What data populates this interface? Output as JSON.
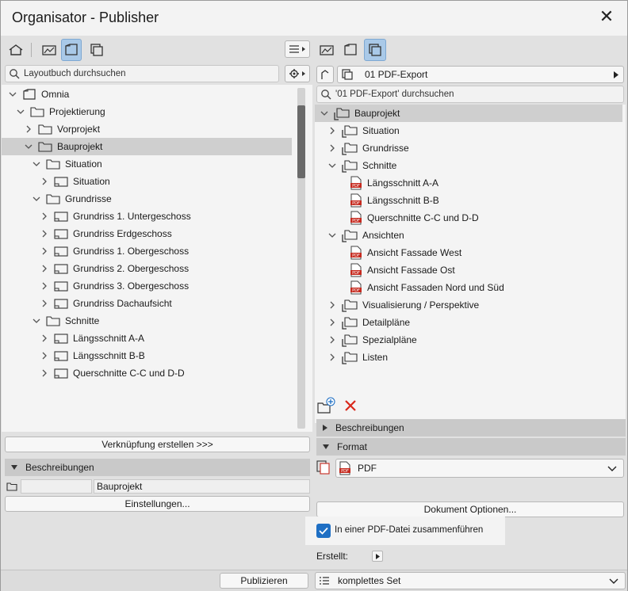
{
  "window": {
    "title": "Organisator - Publisher",
    "close_glyph": "✕"
  },
  "left": {
    "search_placeholder": "Layoutbuch durchsuchen",
    "tree": [
      {
        "label": "Omnia",
        "depth": 0,
        "expanded": true,
        "icon": "book-icon"
      },
      {
        "label": "Projektierung",
        "depth": 1,
        "expanded": true,
        "icon": "folder-icon"
      },
      {
        "label": "Vorprojekt",
        "depth": 2,
        "expanded": false,
        "icon": "folder-icon"
      },
      {
        "label": "Bauprojekt",
        "depth": 2,
        "expanded": true,
        "icon": "folder-icon",
        "selected": true
      },
      {
        "label": "Situation",
        "depth": 3,
        "expanded": true,
        "icon": "folder-icon"
      },
      {
        "label": "Situation",
        "depth": 4,
        "expanded": false,
        "icon": "layout-icon"
      },
      {
        "label": "Grundrisse",
        "depth": 3,
        "expanded": true,
        "icon": "folder-icon"
      },
      {
        "label": "Grundriss 1. Untergeschoss",
        "depth": 4,
        "expanded": false,
        "icon": "layout-icon"
      },
      {
        "label": "Grundriss Erdgeschoss",
        "depth": 4,
        "expanded": false,
        "icon": "layout-icon"
      },
      {
        "label": "Grundriss 1. Obergeschoss",
        "depth": 4,
        "expanded": false,
        "icon": "layout-icon"
      },
      {
        "label": "Grundriss 2. Obergeschoss",
        "depth": 4,
        "expanded": false,
        "icon": "layout-icon"
      },
      {
        "label": "Grundriss 3. Obergeschoss",
        "depth": 4,
        "expanded": false,
        "icon": "layout-icon"
      },
      {
        "label": "Grundriss Dachaufsicht",
        "depth": 4,
        "expanded": false,
        "icon": "layout-icon"
      },
      {
        "label": "Schnitte",
        "depth": 3,
        "expanded": true,
        "icon": "folder-icon"
      },
      {
        "label": "Längsschnitt A-A",
        "depth": 4,
        "expanded": false,
        "icon": "layout-icon"
      },
      {
        "label": "Längsschnitt B-B",
        "depth": 4,
        "expanded": false,
        "icon": "layout-icon"
      },
      {
        "label": "Querschnitte C-C und D-D",
        "depth": 4,
        "expanded": false,
        "icon": "layout-icon"
      }
    ],
    "link_button": "Verknüpfung erstellen >>>",
    "desc_header": "Beschreibungen",
    "desc_value": "Bauprojekt",
    "settings_button": "Einstellungen..."
  },
  "right": {
    "set_name": "01 PDF-Export",
    "search_placeholder": "'01 PDF-Export' durchsuchen",
    "tree": [
      {
        "label": "Bauprojekt",
        "depth": 0,
        "expanded": true,
        "icon": "publish-folder-icon",
        "selected": true
      },
      {
        "label": "Situation",
        "depth": 1,
        "expanded": false,
        "icon": "publish-folder-icon"
      },
      {
        "label": "Grundrisse",
        "depth": 1,
        "expanded": false,
        "icon": "publish-folder-icon"
      },
      {
        "label": "Schnitte",
        "depth": 1,
        "expanded": true,
        "icon": "publish-folder-icon"
      },
      {
        "label": "Längsschnitt A-A",
        "depth": 2,
        "icon": "pdf-icon"
      },
      {
        "label": "Längsschnitt B-B",
        "depth": 2,
        "icon": "pdf-icon"
      },
      {
        "label": "Querschnitte C-C und D-D",
        "depth": 2,
        "icon": "pdf-icon"
      },
      {
        "label": "Ansichten",
        "depth": 1,
        "expanded": true,
        "icon": "publish-folder-icon"
      },
      {
        "label": "Ansicht Fassade West",
        "depth": 2,
        "icon": "pdf-icon"
      },
      {
        "label": "Ansicht Fassade Ost",
        "depth": 2,
        "icon": "pdf-icon"
      },
      {
        "label": "Ansicht Fassaden Nord und Süd",
        "depth": 2,
        "icon": "pdf-icon"
      },
      {
        "label": "Visualisierung / Perspektive",
        "depth": 1,
        "expanded": false,
        "icon": "publish-folder-icon"
      },
      {
        "label": "Detailpläne",
        "depth": 1,
        "expanded": false,
        "icon": "publish-folder-icon"
      },
      {
        "label": "Spezialpläne",
        "depth": 1,
        "expanded": false,
        "icon": "publish-folder-icon"
      },
      {
        "label": "Listen",
        "depth": 1,
        "expanded": false,
        "icon": "publish-folder-icon"
      }
    ],
    "desc_header": "Beschreibungen",
    "format_header": "Format",
    "format_value": "PDF",
    "pdf_badge": "PDF",
    "doc_options_button": "Dokument Optionen...",
    "merge_label": "In einer PDF-Datei zusammenführen",
    "merge_checked": true,
    "created_label": "Erstellt:"
  },
  "footer": {
    "publish_button": "Publizieren",
    "set_select": "komplettes Set"
  },
  "colors": {
    "accent": "#1e6fc4",
    "active_tool": "#a9c9e8",
    "delete": "#d9281b",
    "pdf": "#c62a1f"
  }
}
